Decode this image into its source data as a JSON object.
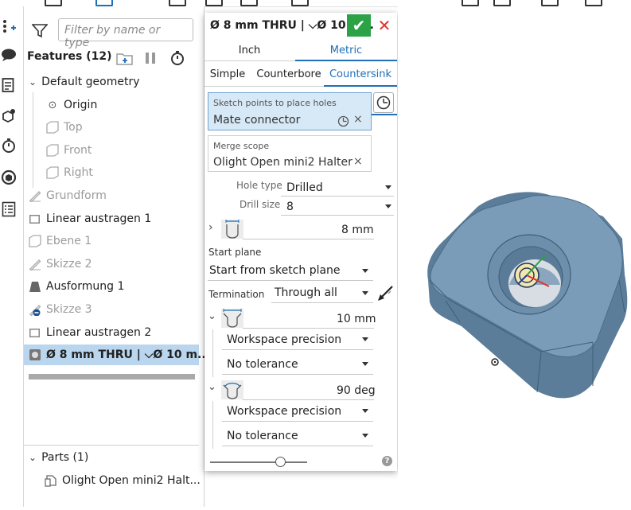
{
  "tree": {
    "filter_placeholder": "Filter by name or type",
    "features_title": "Features (12)",
    "default_geometry": "Default geometry",
    "items": [
      {
        "label": "Origin"
      },
      {
        "label": "Top"
      },
      {
        "label": "Front"
      },
      {
        "label": "Right"
      },
      {
        "label": "Grundform"
      },
      {
        "label": "Linear austragen 1"
      },
      {
        "label": "Ebene 1"
      },
      {
        "label": "Skizze 2"
      },
      {
        "label": "Ausformung 1"
      },
      {
        "label": "Skizze 3"
      },
      {
        "label": "Linear austragen 2"
      },
      {
        "label": "Ø 8 mm THRU | ⌵Ø 10 m..."
      }
    ],
    "parts_title": "Parts (1)",
    "part_name": "Olight Open mini2 Halt..."
  },
  "dialog": {
    "title": "Ø 8 mm THRU | ⌵Ø 10 m...",
    "units": [
      "Inch",
      "Metric"
    ],
    "hole_styles": [
      "Simple",
      "Counterbore",
      "Countersink"
    ],
    "sketch_points_label": "Sketch points to place holes",
    "sketch_points_value": "Mate connector",
    "merge_scope_label": "Merge scope",
    "merge_scope_value": "Olight Open mini2 Halter",
    "hole_type_label": "Hole type",
    "hole_type_value": "Drilled",
    "drill_size_label": "Drill size",
    "drill_size_value": "8",
    "diameter_value": "8 mm",
    "start_plane_label": "Start plane",
    "start_plane_value": "Start from sketch plane",
    "termination_label": "Termination",
    "termination_value": "Through all",
    "csink_diameter_value": "10 mm",
    "precision_1": "Workspace precision",
    "tolerance_1": "No tolerance",
    "csink_angle_value": "90 deg",
    "precision_2": "Workspace precision",
    "tolerance_2": "No tolerance",
    "slider_level": 0.72
  },
  "colors": {
    "accent": "#1f6fb8",
    "ok_green": "#2aa245",
    "cancel_red": "#dd3333",
    "selection": "#b9d6ee",
    "part_blue": "#6b8fae"
  }
}
